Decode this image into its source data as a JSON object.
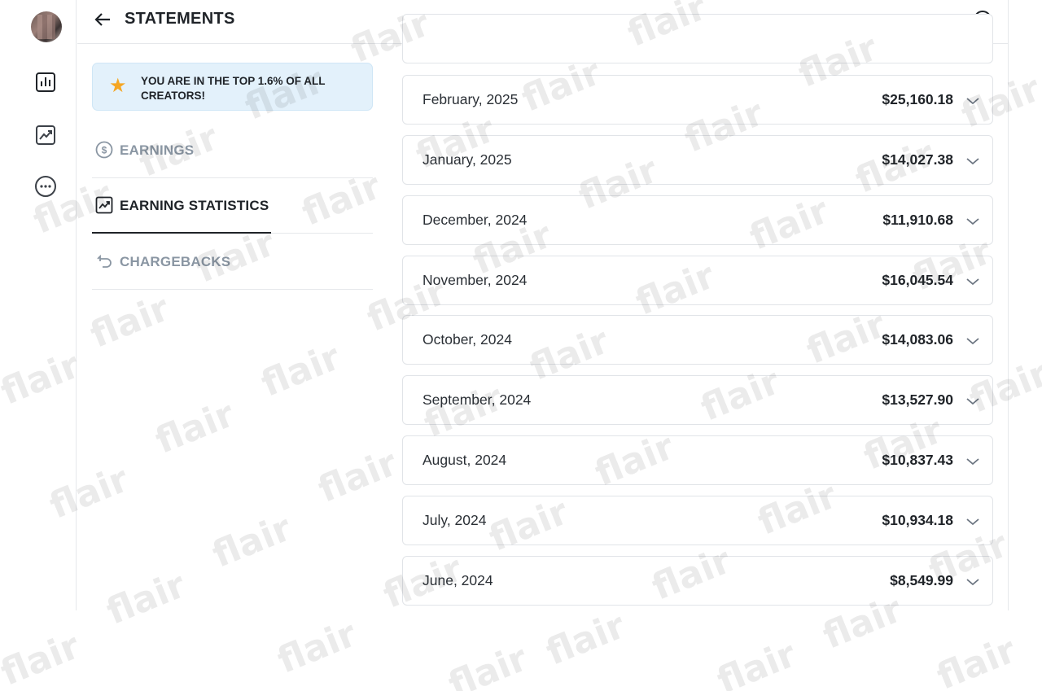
{
  "header": {
    "title": "STATEMENTS"
  },
  "banner": {
    "text": "YOU ARE IN THE TOP 1.6% OF ALL CREATORS!"
  },
  "menu": [
    {
      "label": "EARNINGS",
      "icon": "dollar-circle-icon",
      "active": false
    },
    {
      "label": "EARNING STATISTICS",
      "icon": "trend-chart-icon",
      "active": true
    },
    {
      "label": "CHARGEBACKS",
      "icon": "undo-arrow-icon",
      "active": false
    }
  ],
  "statements": [
    {
      "month": "February, 2025",
      "amount": "$25,160.18"
    },
    {
      "month": "January, 2025",
      "amount": "$14,027.38"
    },
    {
      "month": "December, 2024",
      "amount": "$11,910.68"
    },
    {
      "month": "November, 2024",
      "amount": "$16,045.54"
    },
    {
      "month": "October, 2024",
      "amount": "$14,083.06"
    },
    {
      "month": "September, 2024",
      "amount": "$13,527.90"
    },
    {
      "month": "August, 2024",
      "amount": "$10,837.43"
    },
    {
      "month": "July, 2024",
      "amount": "$10,934.18"
    },
    {
      "month": "June, 2024",
      "amount": "$8,549.99"
    }
  ],
  "watermark": {
    "text": "flair"
  },
  "colors": {
    "accent_star": "#f5a623",
    "banner_bg": "#e3f1fb",
    "muted_text": "#8a96a3"
  }
}
